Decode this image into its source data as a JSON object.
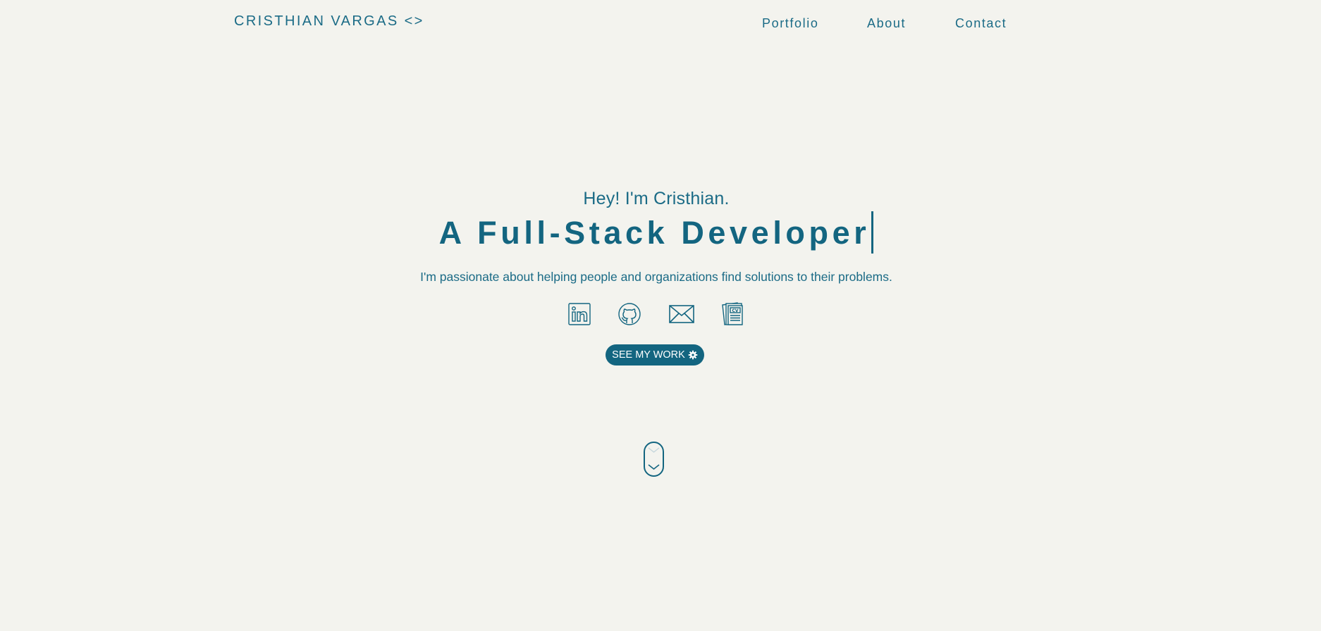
{
  "header": {
    "logo": "CRISTHIAN VARGAS <>",
    "nav": [
      "Portfolio",
      "About",
      "Contact"
    ]
  },
  "hero": {
    "greeting": "Hey! I'm Cristhian.",
    "headline": "A Full-Stack Developer",
    "subtitle": "I'm passionate about helping people and organizations find solutions to their problems.",
    "socials": [
      {
        "icon": "linkedin-icon"
      },
      {
        "icon": "github-icon"
      },
      {
        "icon": "mail-icon"
      },
      {
        "icon": "cv-icon"
      }
    ],
    "cta_label": "SEE MY WORK",
    "cta_icon": "gear-icon"
  },
  "scroll_indicator": {
    "icon": "chevron-down-icon"
  },
  "colors": {
    "background": "#f3f3ee",
    "accent": "#136580",
    "button_text": "#ffffff"
  }
}
